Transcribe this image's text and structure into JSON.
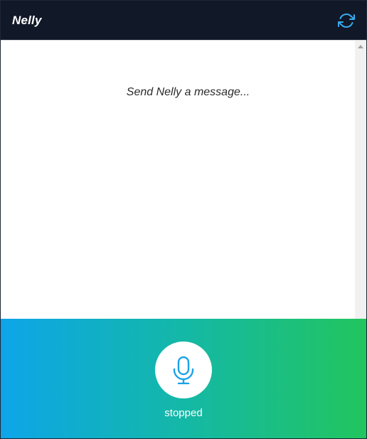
{
  "header": {
    "title": "Nelly",
    "refresh_icon": "refresh-icon"
  },
  "chat": {
    "placeholder": "Send Nelly a message..."
  },
  "voice": {
    "mic_icon": "microphone-icon",
    "status": "stopped"
  },
  "colors": {
    "header_bg": "#111827",
    "accent": "#0ea5e9",
    "gradient_start": "#0ea5e9",
    "gradient_end": "#22c55e"
  }
}
